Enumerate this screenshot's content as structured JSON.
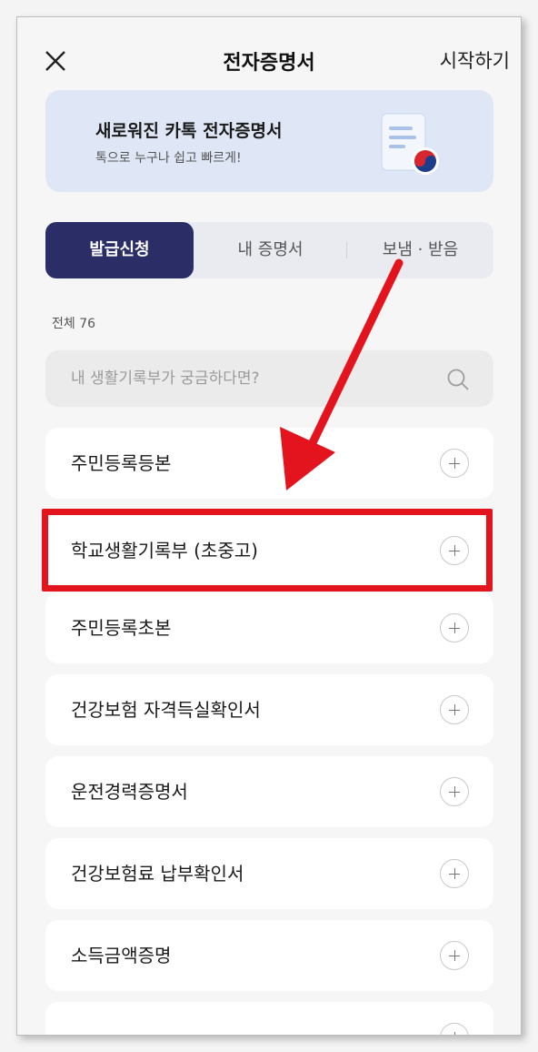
{
  "header": {
    "close_icon": "close-icon",
    "title": "전자증명서",
    "start_label": "시작하기"
  },
  "banner": {
    "title": "새로워진 카톡 전자증명서",
    "subtitle": "톡으로 누구나 쉽고 빠르게!",
    "icon": "certificate-document-icon"
  },
  "tabs": [
    {
      "label": "발급신청",
      "active": true
    },
    {
      "label": "내 증명서",
      "active": false
    },
    {
      "label": "보냄 · 받음",
      "active": false
    }
  ],
  "count_label": "전체 76",
  "search": {
    "placeholder": "내 생활기록부가 궁금하다면?",
    "value": "",
    "icon": "search-icon"
  },
  "items": [
    {
      "label": "주민등록등본"
    },
    {
      "label": "학교생활기록부 (초중고)"
    },
    {
      "label": "주민등록초본"
    },
    {
      "label": "건강보험 자격득실확인서"
    },
    {
      "label": "운전경력증명서"
    },
    {
      "label": "건강보험료 납부확인서"
    },
    {
      "label": "소득금액증명"
    }
  ],
  "annotation": {
    "highlight_color": "#e3141e",
    "highlighted_item": "학교생활기록부 (초중고)"
  },
  "colors": {
    "accent": "#2b2e66",
    "banner_bg": "#dfe7f6"
  }
}
